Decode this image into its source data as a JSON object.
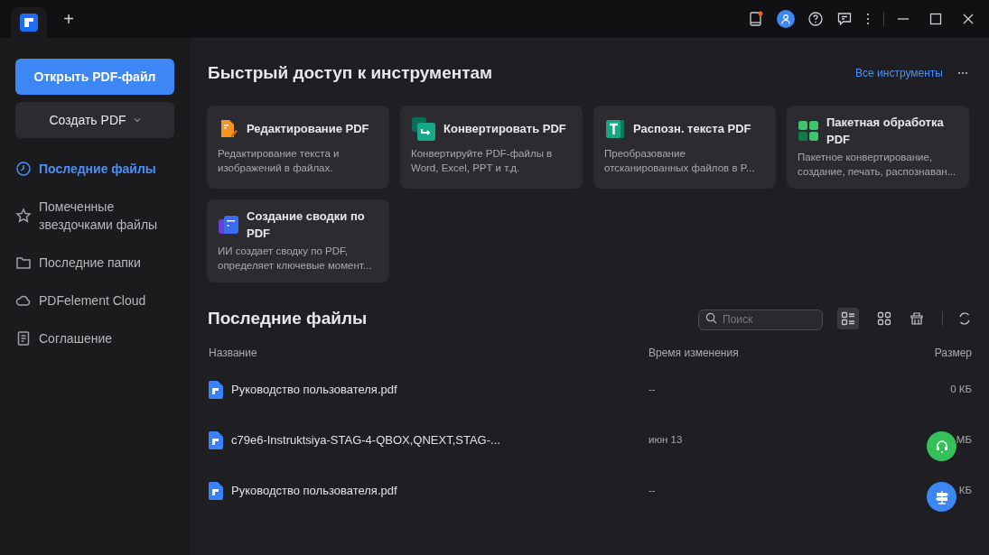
{
  "tab_new": "+",
  "sidebar": {
    "open_button": "Открыть PDF-файл",
    "create_button": "Создать PDF",
    "items": [
      {
        "kind": "clock",
        "label": "Последние файлы",
        "selected": true
      },
      {
        "kind": "star",
        "label": "Помеченные звездочками файлы",
        "selected": false
      },
      {
        "kind": "folder",
        "label": "Последние папки",
        "selected": false
      },
      {
        "kind": "cloud",
        "label": "PDFelement Cloud",
        "selected": false
      },
      {
        "kind": "doc",
        "label": "Соглашение",
        "selected": false
      }
    ]
  },
  "tools": {
    "title": "Быстрый доступ к инструментам",
    "all_link": "Все инструменты",
    "cards": [
      {
        "kind": "edit",
        "title": "Редактирование PDF",
        "description": "Редактирование текста и изображений в файлах."
      },
      {
        "kind": "convert",
        "title": "Конвертировать PDF",
        "description": "Конвертируйте PDF-файлы в Word, Excel, PPT и т.д."
      },
      {
        "kind": "ocr",
        "title": "Распозн. текста PDF",
        "description": "Преобразование отсканированных файлов в P..."
      },
      {
        "kind": "batch",
        "title": "Пакетная обработка PDF",
        "description": "Пакетное конвертирование, создание, печать, распознаван..."
      },
      {
        "kind": "summary",
        "title": "Создание сводки по PDF",
        "description": "ИИ создает сводку по PDF, определяет ключевые момент..."
      }
    ]
  },
  "recent": {
    "title": "Последние файлы",
    "search": {
      "placeholder": "Поиск"
    },
    "view": [
      {
        "kind": "list",
        "selected": true
      },
      {
        "kind": "grid",
        "selected": false
      }
    ],
    "columns": [
      "Название",
      "Время изменения",
      "Размер"
    ],
    "rows": [
      {
        "name": "Руководство пользователя.pdf",
        "modified": "--",
        "size": "0 КБ"
      },
      {
        "name": "c79e6-Instruktsiya-STAG-4-QBOX,QNEXT,STAG-...",
        "modified": "июн 13",
        "size": "МБ"
      },
      {
        "name": "Руководство пользователя.pdf",
        "modified": "--",
        "size": "КБ"
      }
    ]
  }
}
